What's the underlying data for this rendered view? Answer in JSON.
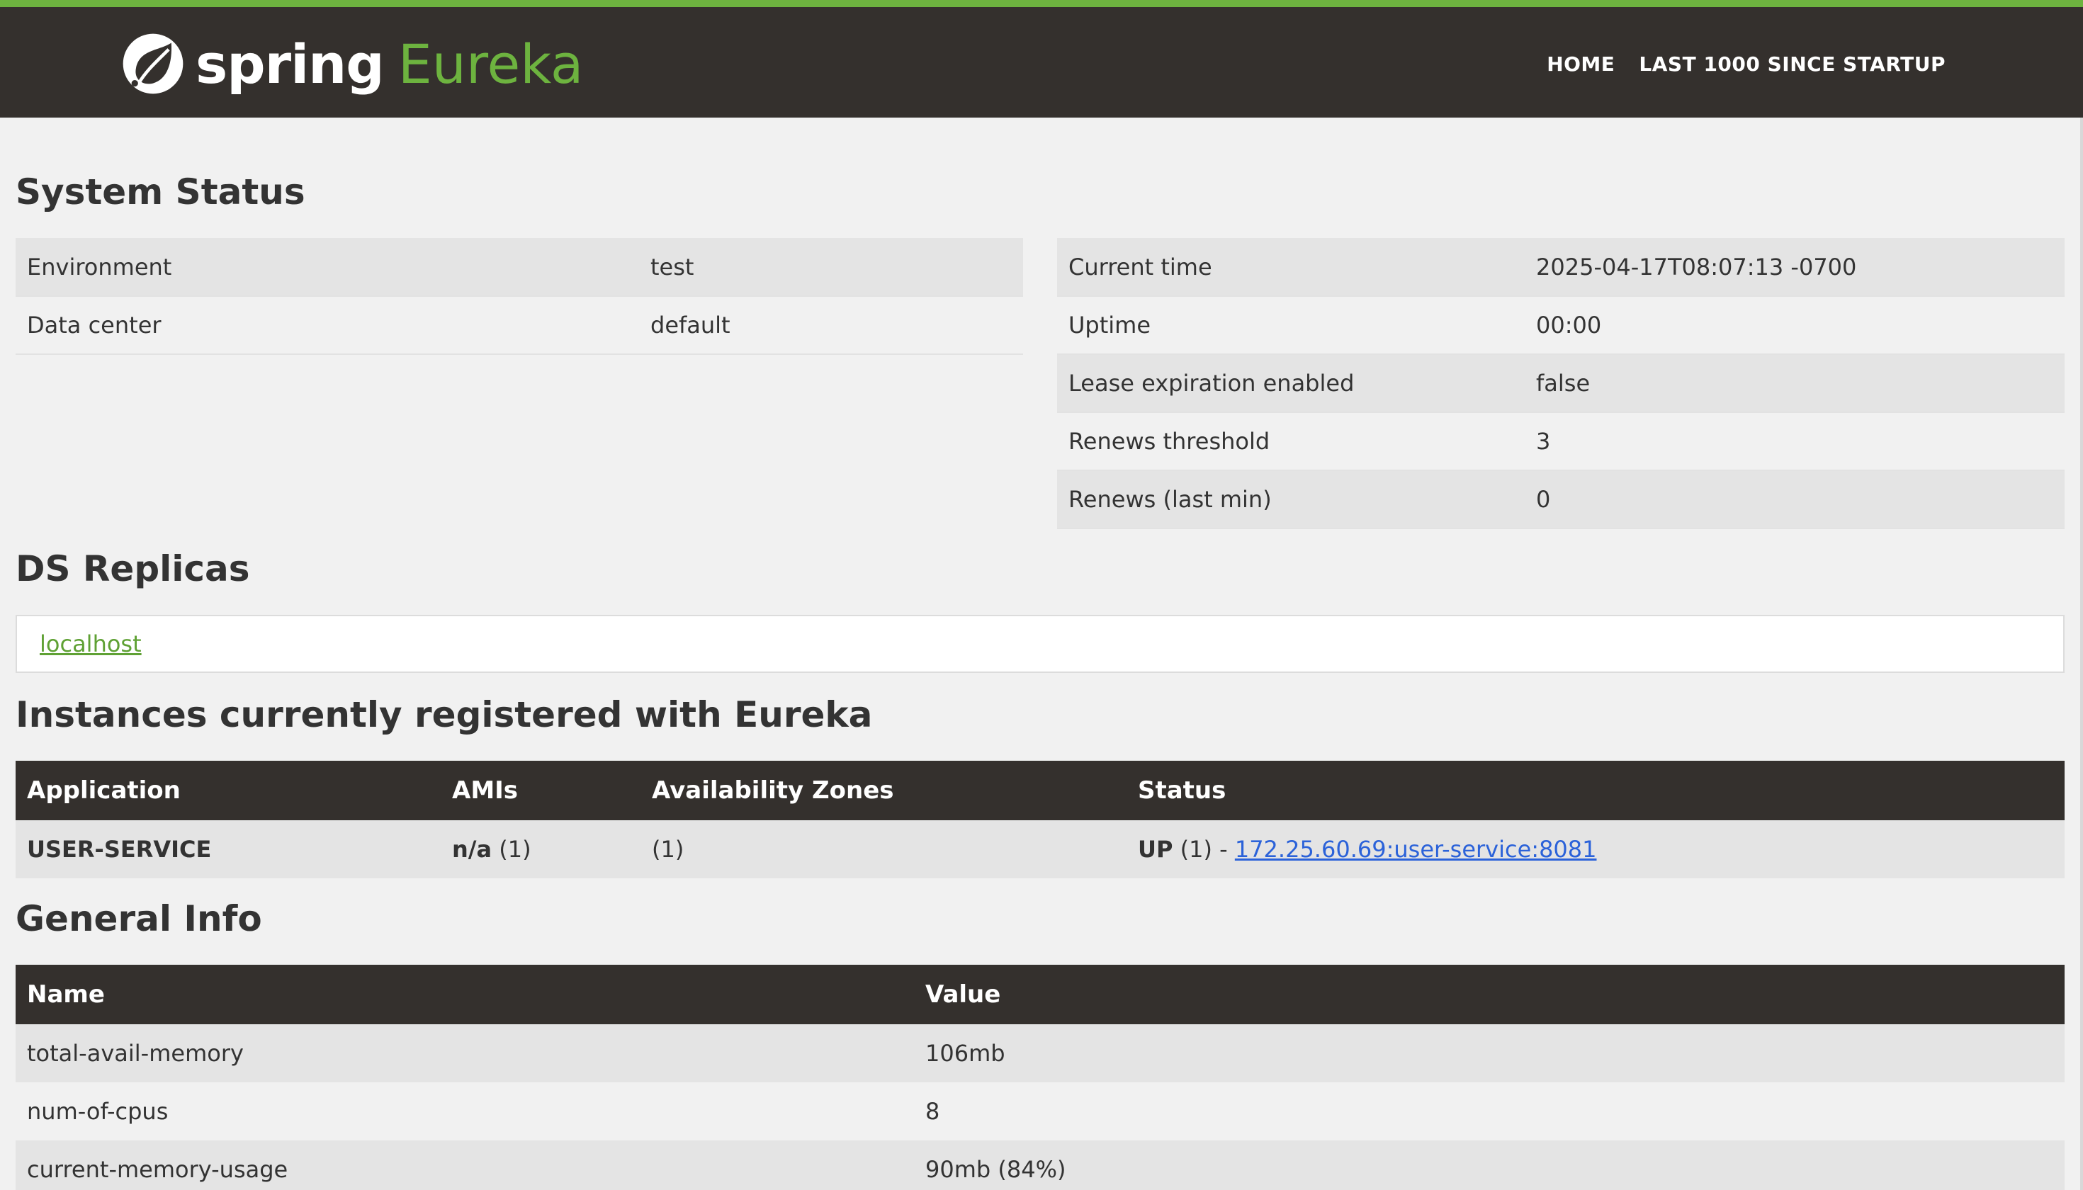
{
  "header": {
    "brand_spring": "spring",
    "brand_eureka": "Eureka",
    "nav": [
      "HOME",
      "LAST 1000 SINCE STARTUP"
    ],
    "logo_icon": "spring-leaf-icon",
    "accent_color": "#6db33f",
    "bar_color": "#34302d"
  },
  "system_status": {
    "title": "System Status",
    "left": [
      {
        "label": "Environment",
        "value": "test"
      },
      {
        "label": "Data center",
        "value": "default"
      }
    ],
    "right": [
      {
        "label": "Current time",
        "value": "2025-04-17T08:07:13 -0700"
      },
      {
        "label": "Uptime",
        "value": "00:00"
      },
      {
        "label": "Lease expiration enabled",
        "value": "false"
      },
      {
        "label": "Renews threshold",
        "value": "3"
      },
      {
        "label": "Renews (last min)",
        "value": "0"
      }
    ]
  },
  "ds_replicas": {
    "title": "DS Replicas",
    "items": [
      "localhost"
    ]
  },
  "instances": {
    "title": "Instances currently registered with Eureka",
    "columns": [
      "Application",
      "AMIs",
      "Availability Zones",
      "Status"
    ],
    "rows": [
      {
        "application": "USER-SERVICE",
        "amis_bold": "n/a",
        "amis_count": "(1)",
        "zones": "(1)",
        "status_bold": "UP",
        "status_count": "(1) -",
        "instance_link": "172.25.60.69:user-service:8081"
      }
    ]
  },
  "general_info": {
    "title": "General Info",
    "columns": [
      "Name",
      "Value"
    ],
    "rows": [
      {
        "name": "total-avail-memory",
        "value": "106mb"
      },
      {
        "name": "num-of-cpus",
        "value": "8"
      },
      {
        "name": "current-memory-usage",
        "value": "90mb (84%)"
      }
    ]
  }
}
